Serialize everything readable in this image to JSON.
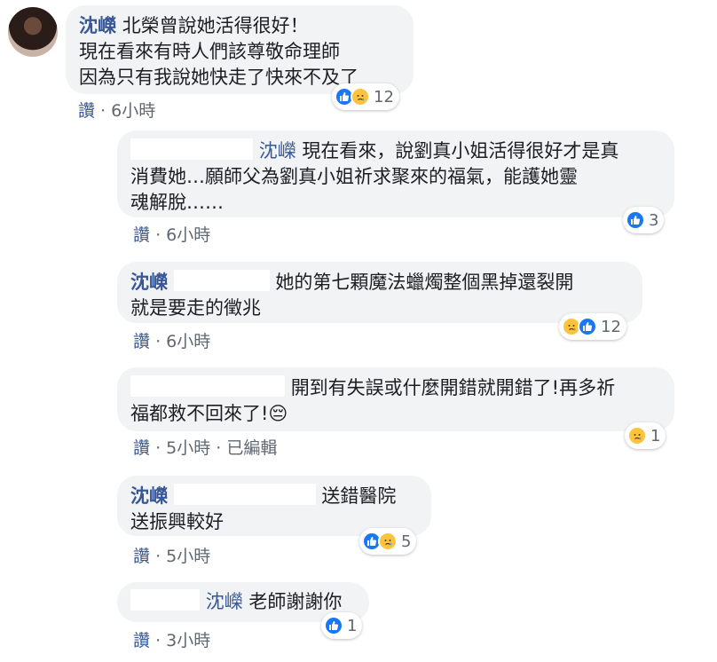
{
  "comments": [
    {
      "author": "沈嶸",
      "line1": "北榮曾說她活得很好！",
      "line2": "現在看來有時人們該尊敬命理師",
      "line3": "因為只有我說她快走了快來不及了",
      "reaction_count": "12",
      "like_label": "讚",
      "time": "6小時"
    },
    {
      "tag": "沈嶸",
      "line1": "現在看來，說劉真小姐活得很好才是真",
      "line2": "消費她…願師父為劉真小姐祈求聚來的福氣，能護她靈",
      "line3": "魂解脫……",
      "reaction_count": "3",
      "like_label": "讚",
      "time": "6小時"
    },
    {
      "author": "沈嶸",
      "line1": "她的第七顆魔法蠟燭整個黑掉還裂開",
      "line2": "就是要走的徵兆",
      "reaction_count": "12",
      "like_label": "讚",
      "time": "6小時"
    },
    {
      "line1": "開到有失誤或什麼開錯就開錯了!再多祈",
      "line2": "福都救不回來了!",
      "emoji": "😔",
      "reaction_count": "1",
      "like_label": "讚",
      "time": "5小時",
      "edited": "已編輯"
    },
    {
      "author": "沈嶸",
      "line1": "送錯醫院",
      "line2": "送振興較好",
      "reaction_count": "5",
      "like_label": "讚",
      "time": "5小時"
    },
    {
      "tag": "沈嶸",
      "line1": "老師謝謝你",
      "reaction_count": "1",
      "like_label": "讚",
      "time": "3小時"
    }
  ],
  "separator": "·"
}
